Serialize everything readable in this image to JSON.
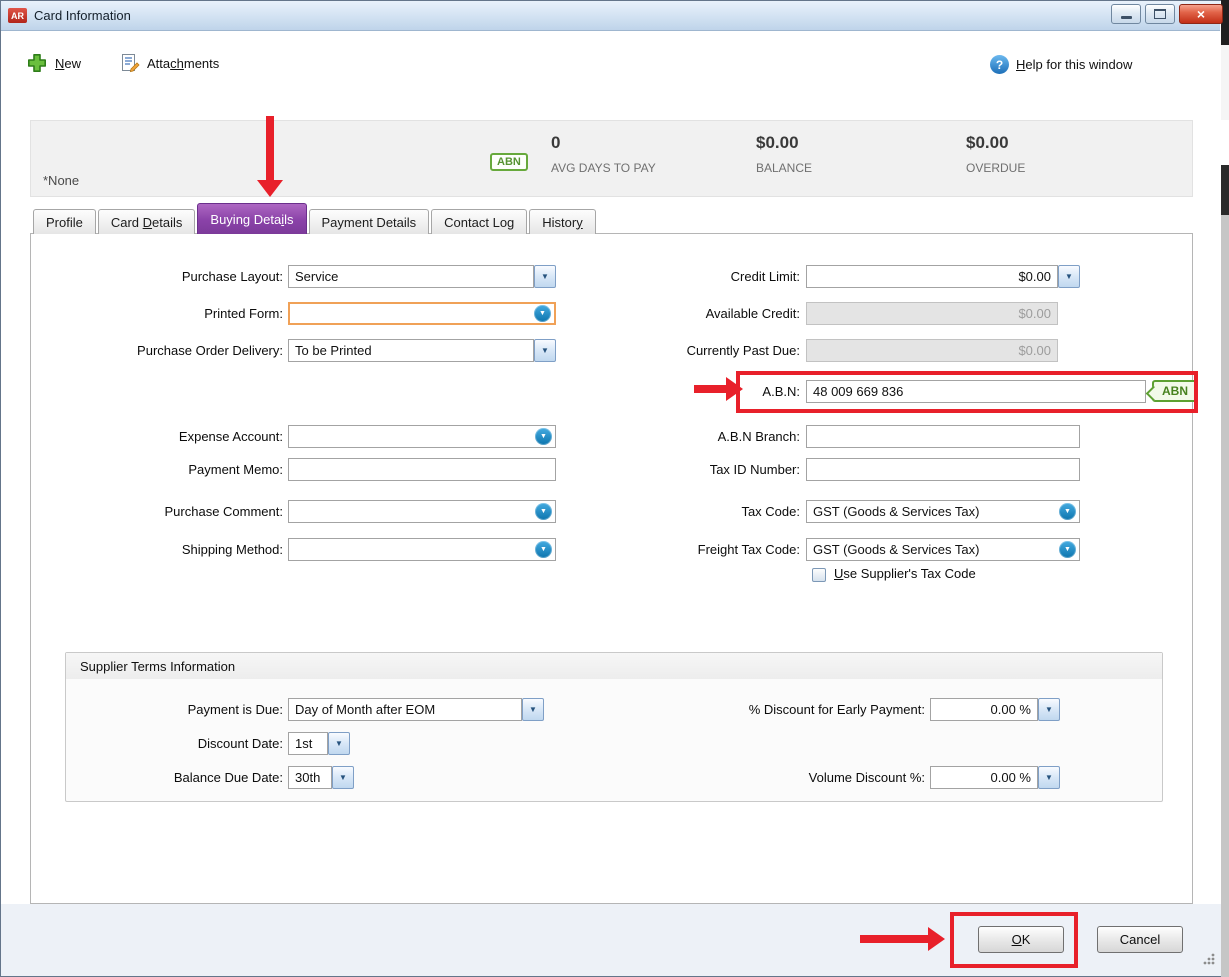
{
  "window": {
    "icon": "AR",
    "title": "Card Information"
  },
  "icons": {
    "close": "×",
    "dropdown_chevron": "▼",
    "help_question": "?"
  },
  "toolbar": {
    "new": {
      "pre": "",
      "u": "N",
      "post": "ew"
    },
    "attachments": {
      "pre": "Atta",
      "u": "ch",
      "post": "ments"
    },
    "help": {
      "pre": "",
      "u": "H",
      "post": "elp for this window"
    }
  },
  "summary": {
    "none_label": "*None",
    "abn_badge": "ABN",
    "metrics": [
      {
        "value": "0",
        "label": "AVG DAYS TO PAY"
      },
      {
        "value": "$0.00",
        "label": "BALANCE"
      },
      {
        "value": "$0.00",
        "label": "OVERDUE"
      }
    ]
  },
  "tabs": [
    {
      "pre": "Profile",
      "u": "",
      "post": ""
    },
    {
      "pre": "Card ",
      "u": "D",
      "post": "etails"
    },
    {
      "pre": "Buying Deta",
      "u": "i",
      "post": "ls"
    },
    {
      "pre": "Payment Details",
      "u": "",
      "post": ""
    },
    {
      "pre": "Contact Lo",
      "u": "g",
      "post": ""
    },
    {
      "pre": "Histor",
      "u": "y",
      "post": ""
    }
  ],
  "fields": {
    "purchase_layout": {
      "label": "Purchase Layout:",
      "value": "Service"
    },
    "printed_form": {
      "label": "Printed Form:",
      "value": ""
    },
    "purchase_order_delivery": {
      "label": "Purchase Order Delivery:",
      "value": "To be Printed"
    },
    "expense_account": {
      "label": "Expense Account:",
      "value": ""
    },
    "payment_memo": {
      "label": "Payment Memo:",
      "value": ""
    },
    "purchase_comment": {
      "label": "Purchase Comment:",
      "value": ""
    },
    "shipping_method": {
      "label": "Shipping Method:",
      "value": ""
    },
    "credit_limit": {
      "label": "Credit Limit:",
      "value": "$0.00"
    },
    "available_credit": {
      "label": "Available Credit:",
      "value": "$0.00"
    },
    "currently_past_due": {
      "label": "Currently Past Due:",
      "value": "$0.00"
    },
    "abn": {
      "label": "A.B.N:",
      "value": "48 009 669 836",
      "badge": "ABN"
    },
    "abn_branch": {
      "label": "A.B.N Branch:",
      "value": ""
    },
    "tax_id_number": {
      "label": "Tax ID Number:",
      "value": ""
    },
    "tax_code": {
      "label": "Tax Code:",
      "value": "GST (Goods & Services Tax)"
    },
    "freight_tax_code": {
      "label": "Freight Tax Code:",
      "value": "GST (Goods & Services Tax)"
    },
    "use_supplier_tax_code": {
      "pre": "",
      "u": "U",
      "post": "se Supplier's Tax Code"
    }
  },
  "supplier_terms": {
    "title": "Supplier Terms Information",
    "payment_is_due": {
      "label": "Payment is Due:",
      "value": "Day of Month after EOM"
    },
    "discount_date": {
      "label": "Discount Date:",
      "value": "1st"
    },
    "balance_due_date": {
      "label": "Balance Due Date:",
      "value": "30th"
    },
    "early_payment_discount": {
      "label": "% Discount for Early Payment:",
      "value": "0.00 %"
    },
    "volume_discount": {
      "label": "Volume Discount %:",
      "value": "0.00 %"
    }
  },
  "footer": {
    "ok": {
      "pre": "",
      "u": "O",
      "post": "K"
    },
    "cancel_label": "Cancel"
  },
  "colors": {
    "active_tab_purple": "#8a42a8",
    "annotation_red": "#e8202a",
    "abn_green": "#5da032",
    "dropdown_blue": "#0c74ad",
    "focus_orange": "#f0a157"
  }
}
